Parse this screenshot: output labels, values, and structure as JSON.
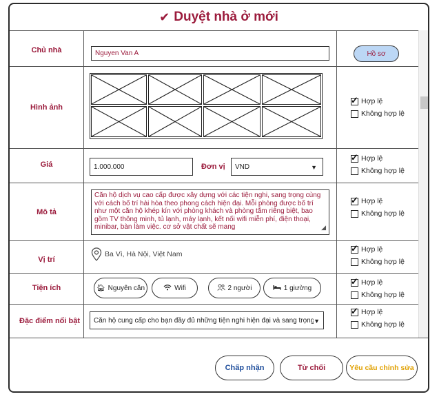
{
  "title": "Duyệt nhà ở mới",
  "rows": {
    "owner": {
      "label": "Chủ nhà",
      "value": "Nguyen Van A",
      "profile_button": "Hồ sơ"
    },
    "images": {
      "label": "Hình ảnh"
    },
    "price": {
      "label": "Giá",
      "value": "1.000.000",
      "unit_label": "Đơn vị",
      "unit_value": "VND"
    },
    "description": {
      "label": "Mô tả",
      "text": "Căn hộ dịch vụ cao cấp được xây dựng với các tiện nghi, sang trọng cùng với cách bố trí hài hòa theo phong cách hiện đại. Mỗi phòng được bố trí như một căn hộ khép kín với phòng khách và phòng tắm riêng biệt, bao gồm TV thông minh, tủ lạnh, máy lạnh, kết nối wifi miễn phí, điện thoại, minibar, bàn làm việc. cơ sở vật chất sẽ mang"
    },
    "location": {
      "label": "Vị trí",
      "value": "Ba Vì, Hà Nội, Việt Nam"
    },
    "amenities": {
      "label": "Tiện ích",
      "items": [
        "Nguyên căn",
        "Wifi",
        "2 người",
        "1 giường"
      ]
    },
    "highlights": {
      "label": "Đặc điểm nổi bật",
      "value": "Căn hộ cung cấp cho bạn đầy đủ những tiện nghi hiện đại và sang trọng"
    }
  },
  "check_labels": {
    "valid": "Hợp lệ",
    "invalid": "Không hợp lệ"
  },
  "actions": {
    "accept": "Chấp nhận",
    "reject": "Từ chối",
    "request_edit": "Yêu cầu chỉnh sửa"
  },
  "colors": {
    "accent": "#9b1b3c",
    "accent_blue": "#1f4e9c",
    "accent_orange": "#e0a000",
    "profile_bg": "#bcd7f5"
  }
}
